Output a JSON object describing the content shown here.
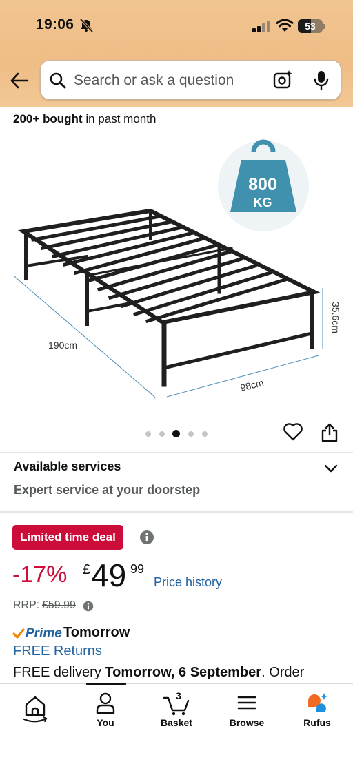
{
  "status_bar": {
    "time": "19:06",
    "battery": "53",
    "battery_level": 0.53
  },
  "search": {
    "placeholder": "Search or ask a question"
  },
  "product": {
    "bought_count": "200+ bought",
    "bought_suffix": "in past month",
    "weight_badge_number": "800",
    "weight_badge_unit": "KG",
    "dim_length": "190cm",
    "dim_width": "98cm",
    "dim_height": "35.6cm",
    "image_count": 5,
    "active_image_index": 2
  },
  "services": {
    "title": "Available services",
    "subtitle": "Expert service at your doorstep"
  },
  "deal": {
    "badge": "Limited time deal",
    "discount": "-17%",
    "currency": "£",
    "price_whole": "49",
    "price_fraction": "99",
    "price_history": "Price history",
    "rrp_label": "RRP:",
    "rrp_value": "£59.99"
  },
  "delivery": {
    "prime_label": "Prime",
    "prime_day": "Tomorrow",
    "free_returns": "FREE Returns",
    "delivery_prefix": "FREE delivery",
    "delivery_date": "Tomorrow, 6 September",
    "delivery_suffix": ". Order"
  },
  "bottom_nav": {
    "home": "",
    "you": "You",
    "basket": "Basket",
    "basket_count": "3",
    "browse": "Browse",
    "rufus": "Rufus"
  },
  "colors": {
    "header_bg": "#f1c591",
    "deal_red": "#cc0c39",
    "link_blue": "#2162a1",
    "prime_check": "#f08804",
    "weight_badge": "#3f91ad"
  }
}
